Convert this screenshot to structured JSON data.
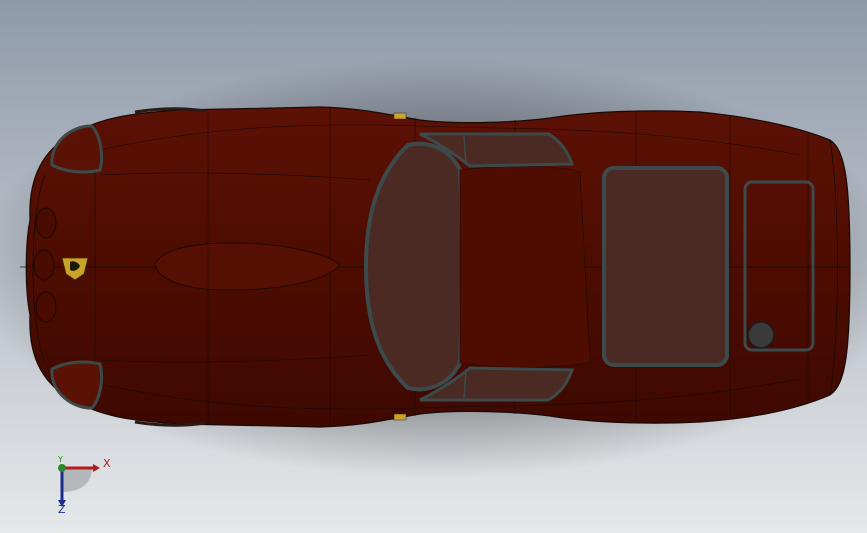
{
  "scene": {
    "background_top": "#8f9aa9",
    "background_bottom": "#e6e8ea",
    "body_color": "#4d0c02",
    "glass_color": "#4a2a22",
    "edge_color": "#1a0a06",
    "trim_color": "#3d4a4c",
    "headlight_cover_color": "#6a1a08",
    "badge_color": "#c9a32a"
  },
  "triad": {
    "x_label": "X",
    "y_label": "Y",
    "z_label": "Z",
    "x_color": "#b21c1c",
    "y_color": "#2a8a2a",
    "z_color": "#1c2c8a"
  }
}
